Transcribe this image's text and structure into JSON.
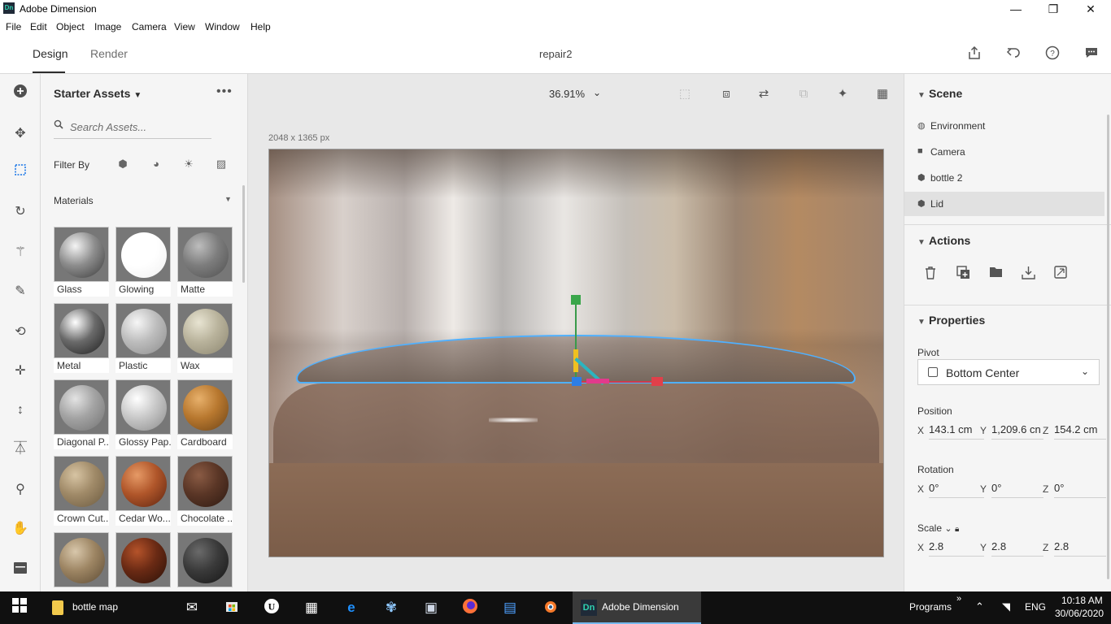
{
  "window": {
    "app_title": "Adobe Dimension",
    "logo_text": "Dn",
    "controls": {
      "minimize": "—",
      "maximize": "❐",
      "close": "✕"
    }
  },
  "menu": [
    "File",
    "Edit",
    "Object",
    "Image",
    "Camera",
    "View",
    "Window",
    "Help"
  ],
  "tabs": {
    "design": "Design",
    "render": "Render"
  },
  "document_title": "repair2",
  "assets": {
    "header": "Starter Assets",
    "more": "•••",
    "search_placeholder": "Search Assets...",
    "filter_label": "Filter By",
    "section_label": "Materials",
    "materials": [
      {
        "name": "Glass",
        "colors": [
          "#f4f4f4",
          "#8d8d8d",
          "#3a3a3a"
        ]
      },
      {
        "name": "Glowing",
        "colors": [
          "#ffffff",
          "#ffffff",
          "#f0f0f0"
        ]
      },
      {
        "name": "Matte",
        "colors": [
          "#bdbdbd",
          "#7d7d7d",
          "#4f4f4f"
        ]
      },
      {
        "name": "Metal",
        "colors": [
          "#ffffff",
          "#6a6a6a",
          "#1e1e1e"
        ]
      },
      {
        "name": "Plastic",
        "colors": [
          "#f6f6f6",
          "#bdbdbd",
          "#8c8c8c"
        ]
      },
      {
        "name": "Wax",
        "colors": [
          "#e8e4d2",
          "#b9b39c",
          "#8c8670"
        ]
      },
      {
        "name": "Diagonal P...",
        "colors": [
          "#e3e3e3",
          "#a3a3a3",
          "#727272"
        ]
      },
      {
        "name": "Glossy Pap...",
        "colors": [
          "#ffffff",
          "#c8c8c8",
          "#8a8a8a"
        ]
      },
      {
        "name": "Cardboard",
        "colors": [
          "#e7b06b",
          "#b8782f",
          "#6d4316"
        ]
      },
      {
        "name": "Crown Cut...",
        "colors": [
          "#d7c4a3",
          "#a08a68",
          "#6b5a40"
        ]
      },
      {
        "name": "Cedar Wo...",
        "colors": [
          "#e69a66",
          "#b0562a",
          "#5e2410"
        ]
      },
      {
        "name": "Chocolate ...",
        "colors": [
          "#8a5b44",
          "#5a3626",
          "#2e1a12"
        ]
      },
      {
        "name": "",
        "colors": [
          "#d8c7ab",
          "#9d8563",
          "#5c4a33"
        ]
      },
      {
        "name": "",
        "colors": [
          "#b5532a",
          "#6a2a14",
          "#2a1108"
        ]
      },
      {
        "name": "",
        "colors": [
          "#6a6a6a",
          "#3a3a3a",
          "#161616"
        ]
      }
    ]
  },
  "canvas": {
    "zoom": "36.91%",
    "size_label": "2048 x 1365 px"
  },
  "scene": {
    "header": "Scene",
    "items": [
      {
        "icon": "globe-icon",
        "glyph": "◍",
        "label": "Environment",
        "selected": false
      },
      {
        "icon": "camera-icon",
        "glyph": "■",
        "label": "Camera",
        "selected": false
      },
      {
        "icon": "model-icon",
        "glyph": "⬢",
        "label": "bottle 2",
        "selected": false
      },
      {
        "icon": "model-icon",
        "glyph": "⬢",
        "label": "Lid",
        "selected": true
      }
    ]
  },
  "actions": {
    "header": "Actions"
  },
  "properties": {
    "header": "Properties",
    "pivot_label": "Pivot",
    "pivot_value": "Bottom Center",
    "position_label": "Position",
    "position": {
      "x": "143.1 cm",
      "y": "1,209.6 cn",
      "z": "154.2 cm"
    },
    "rotation_label": "Rotation",
    "rotation": {
      "x": "0°",
      "y": "0°",
      "z": "0°"
    },
    "scale_label": "Scale",
    "scale": {
      "x": "2.8",
      "y": "2.8",
      "z": "2.8"
    },
    "axis": {
      "x": "X",
      "y": "Y",
      "z": "Z"
    }
  },
  "taskbar": {
    "folder_label": "bottle map",
    "active_app_label": "Adobe Dimension",
    "active_app_logo": "Dn",
    "programs_label": "Programs",
    "language": "ENG",
    "time": "10:18 AM",
    "date": "30/06/2020"
  }
}
